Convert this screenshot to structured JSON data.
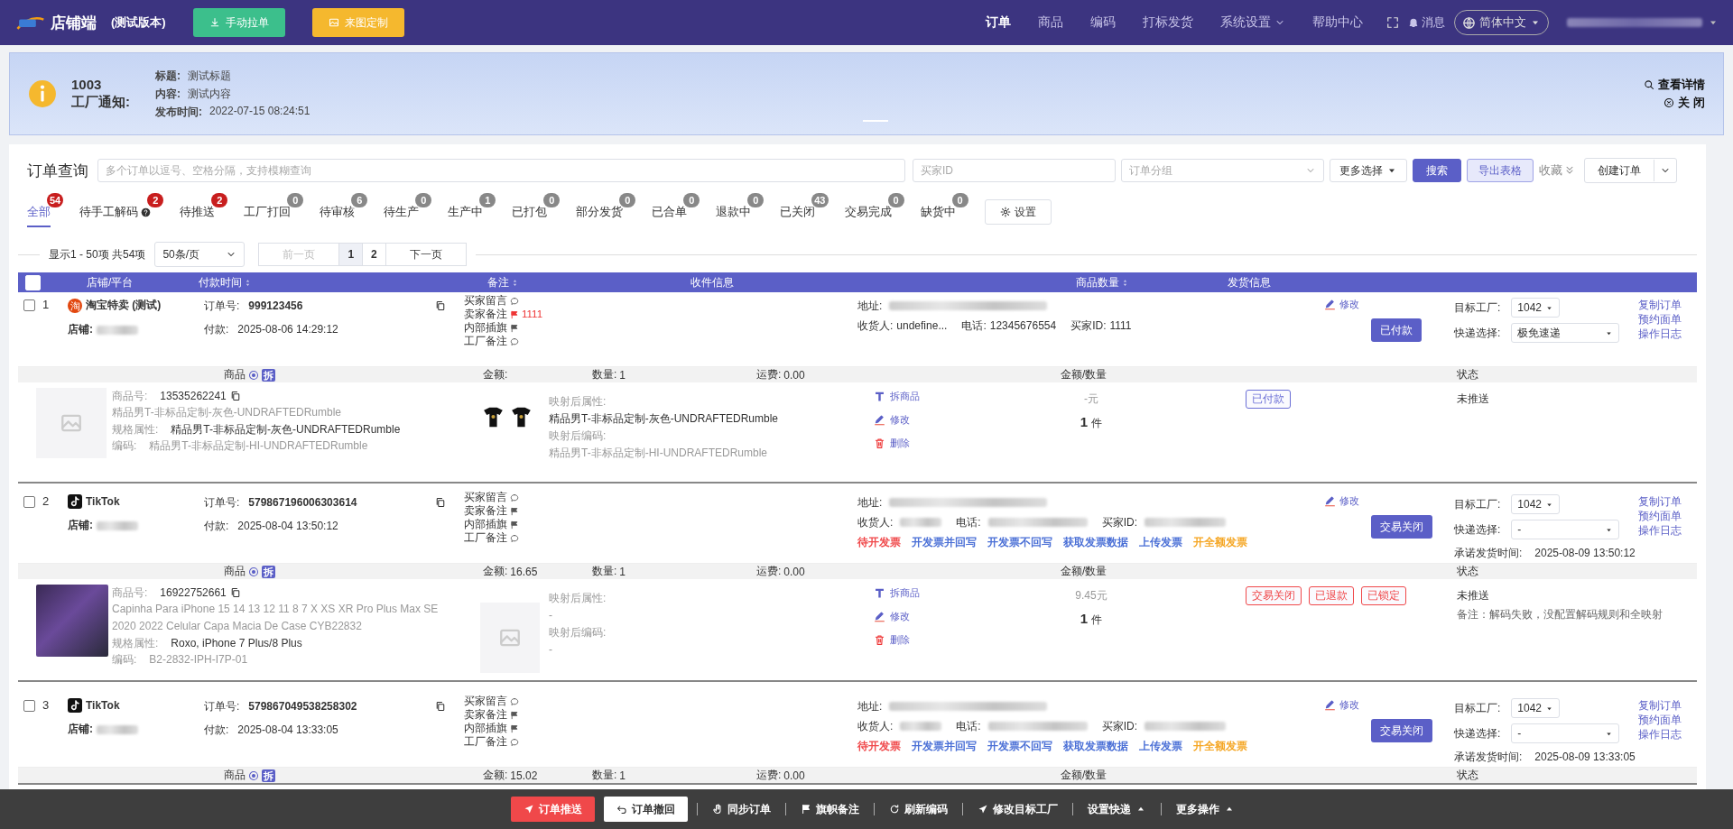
{
  "header": {
    "logo_text": "店铺端",
    "version": "(测试版本)",
    "buttons": [
      {
        "label": "手动拉单",
        "kind": "pull"
      },
      {
        "label": "来图定制",
        "kind": "custom"
      }
    ],
    "nav": [
      {
        "label": "订单",
        "selected": true,
        "dropdown": false
      },
      {
        "label": "商品",
        "selected": false,
        "dropdown": false
      },
      {
        "label": "编码",
        "selected": false,
        "dropdown": false
      },
      {
        "label": "打标发货",
        "selected": false,
        "dropdown": false
      },
      {
        "label": "系统设置",
        "selected": false,
        "dropdown": true
      },
      {
        "label": "帮助中心",
        "selected": false,
        "dropdown": false
      }
    ],
    "message": "消息",
    "language": "简体中文"
  },
  "notice": {
    "id": "1003",
    "label": "工厂通知:",
    "fields": [
      {
        "label": "标题:",
        "value": "测试标题"
      },
      {
        "label": "内容:",
        "value": "测试内容"
      },
      {
        "label": "发布时间:",
        "value": "2022-07-15 08:24:51"
      }
    ],
    "detail_link": "查看详情",
    "close_link": "关 闭"
  },
  "query": {
    "title": "订单查询",
    "search_placeholder": "多个订单以逗号、空格分隔，支持模糊查询",
    "buyer_placeholder": "买家ID",
    "group_placeholder": "订单分组",
    "more": "更多选择",
    "search_button": "搜索",
    "export_button": "导出表格",
    "collapse": "收藏",
    "create_button": "创建订单"
  },
  "tabs": [
    {
      "label": "全部",
      "count": "54",
      "alert": true,
      "selected": true,
      "help": false
    },
    {
      "label": "待手工解码",
      "count": "2",
      "alert": true,
      "selected": false,
      "help": true
    },
    {
      "label": "待推送",
      "count": "2",
      "alert": true,
      "selected": false,
      "help": false
    },
    {
      "label": "工厂打回",
      "count": "0",
      "alert": false,
      "selected": false,
      "help": false
    },
    {
      "label": "待审核",
      "count": "6",
      "alert": false,
      "selected": false,
      "help": false
    },
    {
      "label": "待生产",
      "count": "0",
      "alert": false,
      "selected": false,
      "help": false
    },
    {
      "label": "生产中",
      "count": "1",
      "alert": false,
      "selected": false,
      "help": false
    },
    {
      "label": "已打包",
      "count": "0",
      "alert": false,
      "selected": false,
      "help": false
    },
    {
      "label": "部分发货",
      "count": "0",
      "alert": false,
      "selected": false,
      "help": false
    },
    {
      "label": "已合单",
      "count": "0",
      "alert": false,
      "selected": false,
      "help": false
    },
    {
      "label": "退款中",
      "count": "0",
      "alert": false,
      "selected": false,
      "help": false
    },
    {
      "label": "已关闭",
      "count": "43",
      "alert": false,
      "selected": false,
      "help": false
    },
    {
      "label": "交易完成",
      "count": "0",
      "alert": false,
      "selected": false,
      "help": false
    },
    {
      "label": "缺货中",
      "count": "0",
      "alert": false,
      "selected": false,
      "help": false
    }
  ],
  "settings_button": "设置",
  "pager": {
    "summary": "显示1 - 50项 共54项",
    "page_size": "50条/页",
    "prev": {
      "label": "前一页",
      "disabled": true
    },
    "pages": [
      {
        "label": "1",
        "selected": true
      },
      {
        "label": "2",
        "selected": false
      }
    ],
    "next": {
      "label": "下一页",
      "disabled": false
    }
  },
  "all_checked": false,
  "columns": [
    {
      "label": "店铺/平台",
      "sortable": false
    },
    {
      "label": "付款时间",
      "sortable": true
    },
    {
      "label": "备注",
      "sortable": true
    },
    {
      "label": "收件信息",
      "sortable": false
    },
    {
      "label": "商品数量",
      "sortable": true
    },
    {
      "label": "发货信息",
      "sortable": false
    }
  ],
  "orders": [
    {
      "index": "1",
      "checked": false,
      "platform": {
        "kind": "taobao",
        "name": "淘宝特卖 (测试)",
        "badge": "淘"
      },
      "shop_label": "店铺:",
      "order_no_label": "订单号:",
      "order_no": "999123456",
      "paid_label": "付款:",
      "paid_time": "2025-08-06 14:29:12",
      "notes": [
        {
          "label": "买家留言",
          "kind": "bubble"
        },
        {
          "label": "卖家备注",
          "kind": "flag",
          "value": "1111"
        },
        {
          "label": "内部插旗",
          "kind": "flag"
        },
        {
          "label": "工厂备注",
          "kind": "bubble"
        }
      ],
      "address_label": "地址:",
      "recipient_label": "收货人:",
      "recipient": "undefine...",
      "phone_label": "电话:",
      "phone": "12345676554",
      "buyer_label": "买家ID:",
      "buyer_id": "1111",
      "edit": "修改",
      "status_button": "已付款",
      "factory_label": "目标工厂:",
      "factory": "1042",
      "express_label": "快递选择:",
      "express": "极免速递",
      "actions": [
        "复制订单",
        "预约面单",
        "操作日志"
      ],
      "summary": {
        "product_label": "商品",
        "split": "拆",
        "amount_label": "金额:",
        "qty_label": "数量:",
        "qty": "1",
        "freight_label": "运费:",
        "freight": "0.00",
        "money_qty": "金额/数量",
        "status": "状态"
      },
      "items": [
        {
          "image": {
            "kind": "placeholder"
          },
          "sku_label": "商品号:",
          "sku": "13535262241",
          "title": "精品男T-非标品定制-灰色-UNDRAFTEDRumble",
          "spec_label": "规格属性:",
          "spec": "精品男T-非标品定制-灰色-UNDRAFTEDRumble",
          "code_label": "编码:",
          "code": "精品男T-非标品定制-HI-UNDRAFTEDRumble",
          "mapped_image": {
            "kind": "tshirts"
          },
          "mapped_attr_label": "映射后属性:",
          "mapped_attr": "精品男T-非标品定制-灰色-UNDRAFTEDRumble",
          "mapped_code_label": "映射后编码:",
          "mapped_code": "精品男T-非标品定制-HI-UNDRAFTEDRumble",
          "split": "拆商品",
          "edit": "修改",
          "delete": "删除",
          "price": "-元",
          "qty": "1",
          "qty_unit": "件",
          "tags": [
            {
              "label": "已付款",
              "color": "#6b6fd6"
            }
          ],
          "push_status": "未推送"
        }
      ]
    },
    {
      "index": "2",
      "checked": false,
      "platform": {
        "kind": "tiktok",
        "name": "TikTok"
      },
      "shop_label": "店铺:",
      "order_no_label": "订单号:",
      "order_no": "579867196006303614",
      "paid_label": "付款:",
      "paid_time": "2025-08-04 13:50:12",
      "notes": [
        {
          "label": "买家留言",
          "kind": "bubble"
        },
        {
          "label": "卖家备注",
          "kind": "flag"
        },
        {
          "label": "内部插旗",
          "kind": "flag"
        },
        {
          "label": "工厂备注",
          "kind": "bubble"
        }
      ],
      "address_label": "地址:",
      "recipient_label": "收货人:",
      "phone_label": "电话:",
      "buyer_label": "买家ID:",
      "invoice_links": [
        {
          "label": "待开发票",
          "color": "#f0484a"
        },
        {
          "label": "开发票并回写",
          "color": "#4a6fd6"
        },
        {
          "label": "开发票不回写",
          "color": "#4a6fd6"
        },
        {
          "label": "获取发票数据",
          "color": "#4a6fd6"
        },
        {
          "label": "上传发票",
          "color": "#4a6fd6"
        },
        {
          "label": "开全额发票",
          "color": "#f5a623"
        }
      ],
      "edit": "修改",
      "status_button": "交易关闭",
      "factory_label": "目标工厂:",
      "factory": "1042",
      "express_label": "快递选择:",
      "express": "-",
      "promise_label": "承诺发货时间:",
      "promise_time": "2025-08-09 13:50:12",
      "actions": [
        "复制订单",
        "预约面单",
        "操作日志"
      ],
      "summary": {
        "product_label": "商品",
        "split": "拆",
        "amount_label": "金额:",
        "amount": "16.65",
        "qty_label": "数量:",
        "qty": "1",
        "freight_label": "运费:",
        "freight": "0.00",
        "money_qty": "金额/数量",
        "status": "状态"
      },
      "items": [
        {
          "image": {
            "kind": "photo"
          },
          "sku_label": "商品号:",
          "sku": "16922752661",
          "title": "Capinha Para iPhone 15 14 13 12 11 8 7 X XS XR Pro Plus Max SE 2020 2022 Celular Capa Macia De Case CYB22832",
          "spec_label": "规格属性:",
          "spec": "Roxo, iPhone 7 Plus/8 Plus",
          "code_label": "编码:",
          "code": "B2-2832-IPH-I7P-01",
          "mapped_image": {
            "kind": "placeholder"
          },
          "mapped_attr_label": "映射后属性:",
          "mapped_attr": "-",
          "mapped_code_label": "映射后编码:",
          "mapped_code": "-",
          "split": "拆商品",
          "edit": "修改",
          "delete": "删除",
          "price": "9.45元",
          "qty": "1",
          "qty_unit": "件",
          "tags": [
            {
              "label": "交易关闭",
              "color": "#f0484a"
            },
            {
              "label": "已退款",
              "color": "#f0484a"
            },
            {
              "label": "已锁定",
              "color": "#f0484a"
            }
          ],
          "push_status": "未推送",
          "remark": "备注：解码失败，没配置解码规则和全映射"
        }
      ]
    },
    {
      "index": "3",
      "checked": false,
      "platform": {
        "kind": "tiktok",
        "name": "TikTok"
      },
      "shop_label": "店铺:",
      "order_no_label": "订单号:",
      "order_no": "579867049538258302",
      "paid_label": "付款:",
      "paid_time": "2025-08-04 13:33:05",
      "notes": [
        {
          "label": "买家留言",
          "kind": "bubble"
        },
        {
          "label": "卖家备注",
          "kind": "flag"
        },
        {
          "label": "内部插旗",
          "kind": "flag"
        },
        {
          "label": "工厂备注",
          "kind": "bubble"
        }
      ],
      "address_label": "地址:",
      "recipient_label": "收货人:",
      "phone_label": "电话:",
      "buyer_label": "买家ID:",
      "invoice_links": [
        {
          "label": "待开发票",
          "color": "#f0484a"
        },
        {
          "label": "开发票并回写",
          "color": "#4a6fd6"
        },
        {
          "label": "开发票不回写",
          "color": "#4a6fd6"
        },
        {
          "label": "获取发票数据",
          "color": "#4a6fd6"
        },
        {
          "label": "上传发票",
          "color": "#4a6fd6"
        },
        {
          "label": "开全额发票",
          "color": "#f5a623"
        }
      ],
      "edit": "修改",
      "status_button": "交易关闭",
      "factory_label": "目标工厂:",
      "factory": "1042",
      "express_label": "快递选择:",
      "express": "-",
      "promise_label": "承诺发货时间:",
      "promise_time": "2025-08-09 13:33:05",
      "actions": [
        "复制订单",
        "预约面单",
        "操作日志"
      ],
      "summary": {
        "product_label": "商品",
        "split": "拆",
        "amount_label": "金额:",
        "amount": "15.02",
        "qty_label": "数量:",
        "qty": "1",
        "freight_label": "运费:",
        "freight": "0.00",
        "money_qty": "金额/数量",
        "status": "状态"
      }
    }
  ],
  "bottom_bar": [
    {
      "label": "订单推送",
      "kind": "push",
      "dropdown": false
    },
    {
      "label": "订单撤回",
      "kind": "recall",
      "dropdown": false
    },
    {
      "label": "同步订单",
      "kind": "sync",
      "dropdown": false
    },
    {
      "label": "旗帜备注",
      "kind": "flag",
      "dropdown": false
    },
    {
      "label": "刷新编码",
      "kind": "refresh",
      "dropdown": false
    },
    {
      "label": "修改目标工厂",
      "kind": "factory",
      "dropdown": false
    },
    {
      "label": "设置快递",
      "kind": "plain",
      "dropdown": true
    },
    {
      "label": "更多操作",
      "kind": "plain",
      "dropdown": true
    }
  ]
}
